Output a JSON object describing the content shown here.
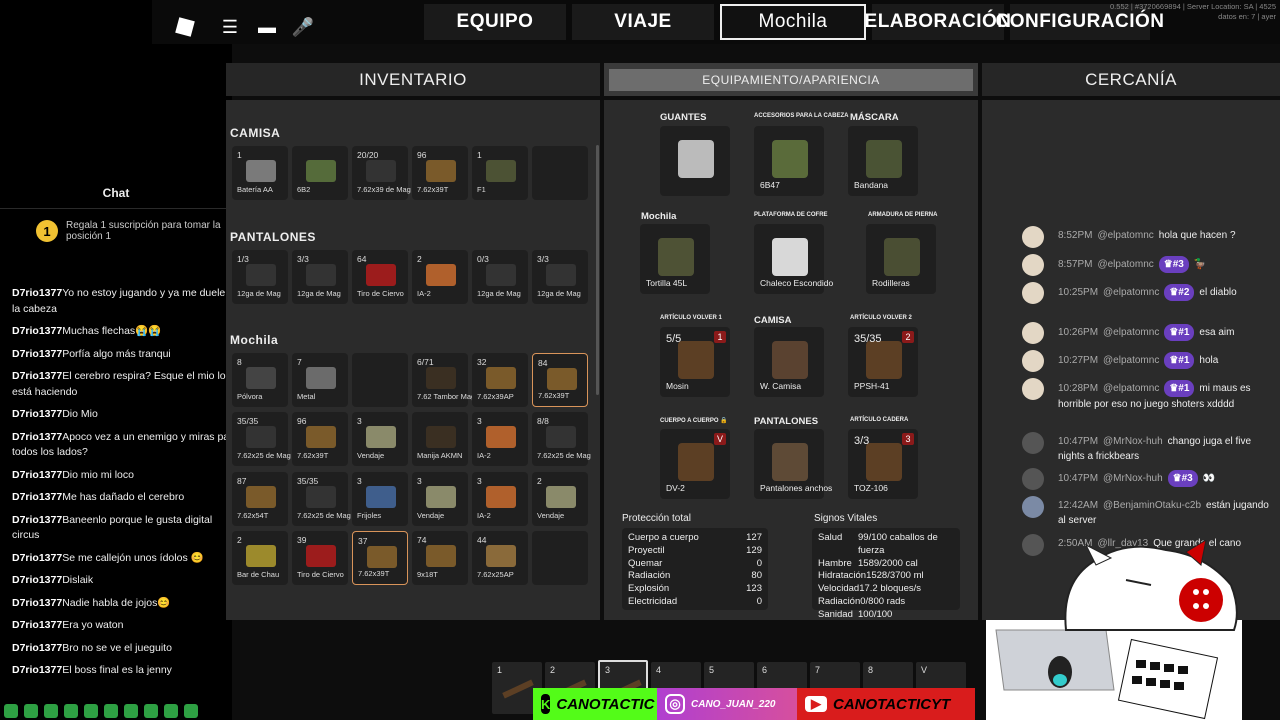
{
  "chat": {
    "title": "Chat",
    "pinned": {
      "badge": "1",
      "text": "Regala 1 suscripción para tomar la posición 1"
    },
    "messages": [
      {
        "user": "D7rio1377",
        "text": "Yo no estoy jugando y ya me duele la cabeza"
      },
      {
        "user": "D7rio1377",
        "text": "Muchas flechas😭😭"
      },
      {
        "user": "D7rio1377",
        "text": "Porfía algo más tranqui"
      },
      {
        "user": "D7rio1377",
        "text": "El cerebro respira? Esque el mio lo está haciendo"
      },
      {
        "user": "D7rio1377",
        "text": "Dio Mio"
      },
      {
        "user": "D7rio1377",
        "text": "Apoco vez a un enemigo y miras pa todos los lados?"
      },
      {
        "user": "D7rio1377",
        "text": "Dio mio mi loco"
      },
      {
        "user": "D7rio1377",
        "text": "Me has dañado el cerebro"
      },
      {
        "user": "D7rio1377",
        "text": "Baneenlo porque le gusta digital circus"
      },
      {
        "user": "D7rio1377",
        "text": "Se me callejón unos ídolos 😊"
      },
      {
        "user": "D7rio1377",
        "text": "Dislaik"
      },
      {
        "user": "D7rio1377",
        "text": "Nadie habla de jojos😊"
      },
      {
        "user": "D7rio1377",
        "text": "Era yo waton"
      },
      {
        "user": "D7rio1377",
        "text": "Bro no se ve el jueguito"
      },
      {
        "user": "D7rio1377",
        "text": "El boss final es la jenny"
      }
    ]
  },
  "tabs": [
    {
      "label": "EQUIPO",
      "active": false
    },
    {
      "label": "VIAJE",
      "active": false
    },
    {
      "label": "Mochila",
      "active": true
    },
    {
      "label": "ELABORACIÓN",
      "active": false
    },
    {
      "label": "CONFIGURACIÓN",
      "active": false
    }
  ],
  "server_info": {
    "line1": "0.552 | #3720669894 | Server Location: SA | 4525",
    "line2": "datos en: 7 | ayer"
  },
  "panels": {
    "inventory": "INVENTARIO",
    "equipment": "EQUIPAMIENTO/APARIENCIA",
    "nearby": "CERCANÍA"
  },
  "inventory": {
    "sections": [
      "CAMISA",
      "PANTALONES",
      "Mochila"
    ],
    "camisa": [
      {
        "count": "1",
        "name": "Batería AA",
        "color": "#7a7a7a"
      },
      {
        "count": "",
        "name": "6B2",
        "color": "#556b3a"
      },
      {
        "count": "20/20",
        "name": "7.62x39 de Mag",
        "color": "#333"
      },
      {
        "count": "96",
        "name": "7.62x39T",
        "color": "#7a5a2a"
      },
      {
        "count": "1",
        "name": "F1",
        "color": "#4c5234"
      },
      {
        "count": "",
        "name": "",
        "color": ""
      }
    ],
    "pantalones": [
      {
        "count": "1/3",
        "name": "12ga de Mag",
        "color": "#333"
      },
      {
        "count": "3/3",
        "name": "12ga de Mag",
        "color": "#333"
      },
      {
        "count": "64",
        "name": "Tiro de Ciervo",
        "color": "#9c1c1c"
      },
      {
        "count": "2",
        "name": "IA-2",
        "color": "#b0602c"
      },
      {
        "count": "0/3",
        "name": "12ga de Mag",
        "color": "#333"
      },
      {
        "count": "3/3",
        "name": "12ga de Mag",
        "color": "#333"
      }
    ],
    "mochila": [
      {
        "count": "8",
        "name": "Pólvora",
        "color": "#444",
        "sel": false
      },
      {
        "count": "7",
        "name": "Metal",
        "color": "#6b6b6b",
        "sel": false
      },
      {
        "count": "",
        "name": "",
        "color": "",
        "sel": false
      },
      {
        "count": "6/71",
        "name": "7.62 Tambor Mag",
        "color": "#3a2f22",
        "sel": false
      },
      {
        "count": "32",
        "name": "7.62x39AP",
        "color": "#7a5a2a",
        "sel": false
      },
      {
        "count": "84",
        "name": "7.62x39T",
        "color": "#7a5a2a",
        "sel": true
      },
      {
        "count": "35/35",
        "name": "7.62x25 de Mag",
        "color": "#333",
        "sel": false
      },
      {
        "count": "96",
        "name": "7.62x39T",
        "color": "#7a5a2a",
        "sel": false
      },
      {
        "count": "3",
        "name": "Vendaje",
        "color": "#8a8a6a",
        "sel": false
      },
      {
        "count": "",
        "name": "Manija AKMN",
        "color": "#3a2f22",
        "sel": false
      },
      {
        "count": "3",
        "name": "IA-2",
        "color": "#b0602c",
        "sel": false
      },
      {
        "count": "8/8",
        "name": "7.62x25 de Mag",
        "color": "#333",
        "sel": false
      },
      {
        "count": "87",
        "name": "7.62x54T",
        "color": "#7a5a2a",
        "sel": false
      },
      {
        "count": "35/35",
        "name": "7.62x25 de Mag",
        "color": "#333",
        "sel": false
      },
      {
        "count": "3",
        "name": "Frijoles",
        "color": "#3f5e8c",
        "sel": false
      },
      {
        "count": "3",
        "name": "Vendaje",
        "color": "#8a8a6a",
        "sel": false
      },
      {
        "count": "3",
        "name": "IA-2",
        "color": "#b0602c",
        "sel": false
      },
      {
        "count": "2",
        "name": "Vendaje",
        "color": "#8a8a6a",
        "sel": false
      },
      {
        "count": "2",
        "name": "Bar de Chau",
        "color": "#9c8a2c",
        "sel": false
      },
      {
        "count": "39",
        "name": "Tiro de Ciervo",
        "color": "#9c1c1c",
        "sel": false
      },
      {
        "count": "37",
        "name": "7.62x39T",
        "color": "#7a5a2a",
        "sel": true
      },
      {
        "count": "74",
        "name": "9x18T",
        "color": "#7a5a2a",
        "sel": false
      },
      {
        "count": "44",
        "name": "7.62x25AP",
        "color": "#8a6a3a",
        "sel": false
      },
      {
        "count": "",
        "name": "",
        "color": "",
        "sel": false
      }
    ]
  },
  "equipment": {
    "slots": [
      {
        "label": "GUANTES",
        "small": false,
        "name": "",
        "count": "",
        "badge": "",
        "color": "#bbb"
      },
      {
        "label": "ACCESORIOS PARA LA CABEZA",
        "small": true,
        "name": "6B47",
        "count": "",
        "badge": "",
        "color": "#5a6b3a"
      },
      {
        "label": "MÁSCARA",
        "small": false,
        "name": "Bandana",
        "count": "",
        "badge": "",
        "color": "#4a5334"
      },
      {
        "label": "Mochila",
        "small": false,
        "name": "Tortilla 45L",
        "count": "",
        "badge": "",
        "color": "#4e5235"
      },
      {
        "label": "PLATAFORMA DE COFRE",
        "small": true,
        "name": "Chaleco Escondido",
        "count": "",
        "badge": "",
        "color": "#d8d8d8"
      },
      {
        "label": "ARMADURA DE PIERNA",
        "small": true,
        "name": "Rodilleras",
        "count": "",
        "badge": "",
        "color": "#4a4e33"
      },
      {
        "label": "ARTÍCULO VOLVER 1",
        "small": true,
        "name": "Mosin",
        "count": "5/5",
        "badge": "1",
        "color": "#5c3f24"
      },
      {
        "label": "CAMISA",
        "small": false,
        "name": "W. Camisa",
        "count": "",
        "badge": "",
        "color": "#5a4230"
      },
      {
        "label": "ARTÍCULO VOLVER 2",
        "small": true,
        "name": "PPSH-41",
        "count": "35/35",
        "badge": "2",
        "color": "#5c3f24"
      },
      {
        "label": "CUERPO A CUERPO 🔒",
        "small": true,
        "name": "DV-2",
        "count": "",
        "badge": "V",
        "color": "#5c3f24"
      },
      {
        "label": "PANTALONES",
        "small": false,
        "name": "Pantalones anchos",
        "count": "",
        "badge": "",
        "color": "#5e4a36"
      },
      {
        "label": "ARTÍCULO CADERA",
        "small": true,
        "name": "TOZ-106",
        "count": "3/3",
        "badge": "3",
        "color": "#5c3f24"
      }
    ],
    "protection_title": "Protección total",
    "protection": [
      {
        "k": "Cuerpo a cuerpo",
        "v": "127"
      },
      {
        "k": "Proyectil",
        "v": "129"
      },
      {
        "k": "Quemar",
        "v": "0"
      },
      {
        "k": "Radiación",
        "v": "80"
      },
      {
        "k": "Explosión",
        "v": "123"
      },
      {
        "k": "Electricidad",
        "v": "0"
      }
    ],
    "vitals_title": "Signos Vitales",
    "vitals": [
      {
        "k": "Salud",
        "v": "99/100 caballos de fuerza"
      },
      {
        "k": "Hambre",
        "v": "1589/2000 cal"
      },
      {
        "k": "Hidratación",
        "v": "1528/3700 ml"
      },
      {
        "k": "Velocidad",
        "v": "17.2 bloques/s"
      },
      {
        "k": "Radiación",
        "v": "0/800 rads"
      },
      {
        "k": "Sanidad",
        "v": "100/100"
      }
    ]
  },
  "live_chat": [
    {
      "time": "8:52PM",
      "user": "@elpatomnc",
      "member": "",
      "text": "hola que hacen ?"
    },
    {
      "time": "8:57PM",
      "user": "@elpatomnc",
      "member": "#3",
      "text": "🦆"
    },
    {
      "time": "10:25PM",
      "user": "@elpatomnc",
      "member": "#2",
      "text": "el diablo"
    },
    {
      "time": "10:26PM",
      "user": "@elpatomnc",
      "member": "#1",
      "text": "esa aim"
    },
    {
      "time": "10:27PM",
      "user": "@elpatomnc",
      "member": "#1",
      "text": "hola"
    },
    {
      "time": "10:28PM",
      "user": "@elpatomnc",
      "member": "#1",
      "text": "mi maus es horrible por eso no juego shoters xdddd"
    },
    {
      "time": "10:47PM",
      "user": "@MrNox-huh",
      "member": "",
      "text": "chango juga el five nights a frickbears"
    },
    {
      "time": "10:47PM",
      "user": "@MrNox-huh",
      "member": "#3",
      "text": "👀"
    },
    {
      "time": "12:42AM",
      "user": "@BenjaminOtaku-c2b",
      "member": "",
      "text": "están jugando al server"
    },
    {
      "time": "2:50AM",
      "user": "@llr_day13",
      "member": "",
      "text": "Que grande el cano"
    }
  ],
  "hotbar": [
    {
      "n": "1",
      "gun": true
    },
    {
      "n": "2",
      "gun": true
    },
    {
      "n": "3",
      "gun": true,
      "active": true
    },
    {
      "n": "4",
      "gun": false
    },
    {
      "n": "5",
      "gun": false
    },
    {
      "n": "6",
      "gun": false
    },
    {
      "n": "7",
      "gun": false
    },
    {
      "n": "8",
      "gun": false
    },
    {
      "n": "V",
      "gun": false
    }
  ],
  "socials": {
    "kick": "CANOTACTIC",
    "instagram": "CANO_JUAN_220",
    "youtube": "CANOTACTICYT"
  }
}
